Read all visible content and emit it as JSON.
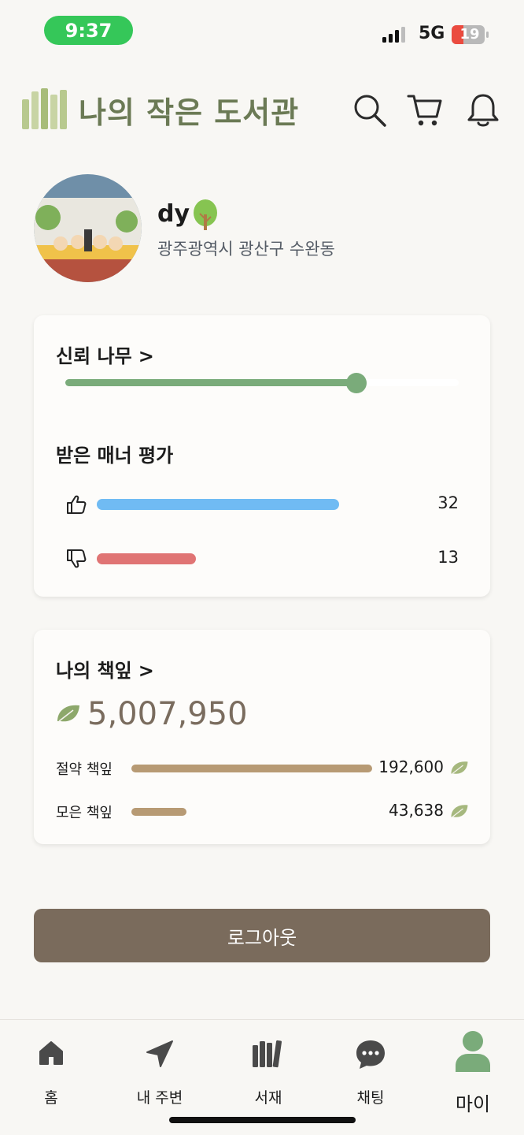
{
  "status_bar": {
    "time": "9:37",
    "network": "5G",
    "battery": "19"
  },
  "app": {
    "title": "나의 작은 도서관"
  },
  "profile": {
    "username": "dy",
    "location": "광주광역시 광산구 수완동"
  },
  "trust": {
    "title": "신뢰 나무",
    "chevron": ">",
    "level": 0.74
  },
  "manners": {
    "title": "받은 매너 평가",
    "rows": [
      {
        "icon": "thumbs-up-icon",
        "count": "32",
        "fraction": 0.61,
        "color": "#70bbf3"
      },
      {
        "icon": "thumbs-down-icon",
        "count": "13",
        "fraction": 0.25,
        "color": "#e07474"
      }
    ]
  },
  "leaves": {
    "title": "나의 책잎",
    "chevron": ">",
    "total": "5,007,950",
    "rows": [
      {
        "label": "절약 책잎",
        "value": "192,600",
        "fraction": 1.0
      },
      {
        "label": "모은 책잎",
        "value": "43,638",
        "fraction": 0.23
      }
    ]
  },
  "logout_label": "로그아웃",
  "nav": {
    "items": [
      {
        "label": "홈",
        "icon": "home-icon"
      },
      {
        "label": "내 주변",
        "icon": "navigation-arrow-icon"
      },
      {
        "label": "서재",
        "icon": "bookshelf-icon"
      },
      {
        "label": "채팅",
        "icon": "chat-bubble-icon"
      },
      {
        "label": "마이",
        "icon": "person-icon",
        "active": true
      }
    ]
  },
  "colors": {
    "accent_green": "#7aab7a",
    "brand_olive": "#6b7a55",
    "logout_brown": "#7a6b5c",
    "leaf_bar": "#b79a74"
  }
}
